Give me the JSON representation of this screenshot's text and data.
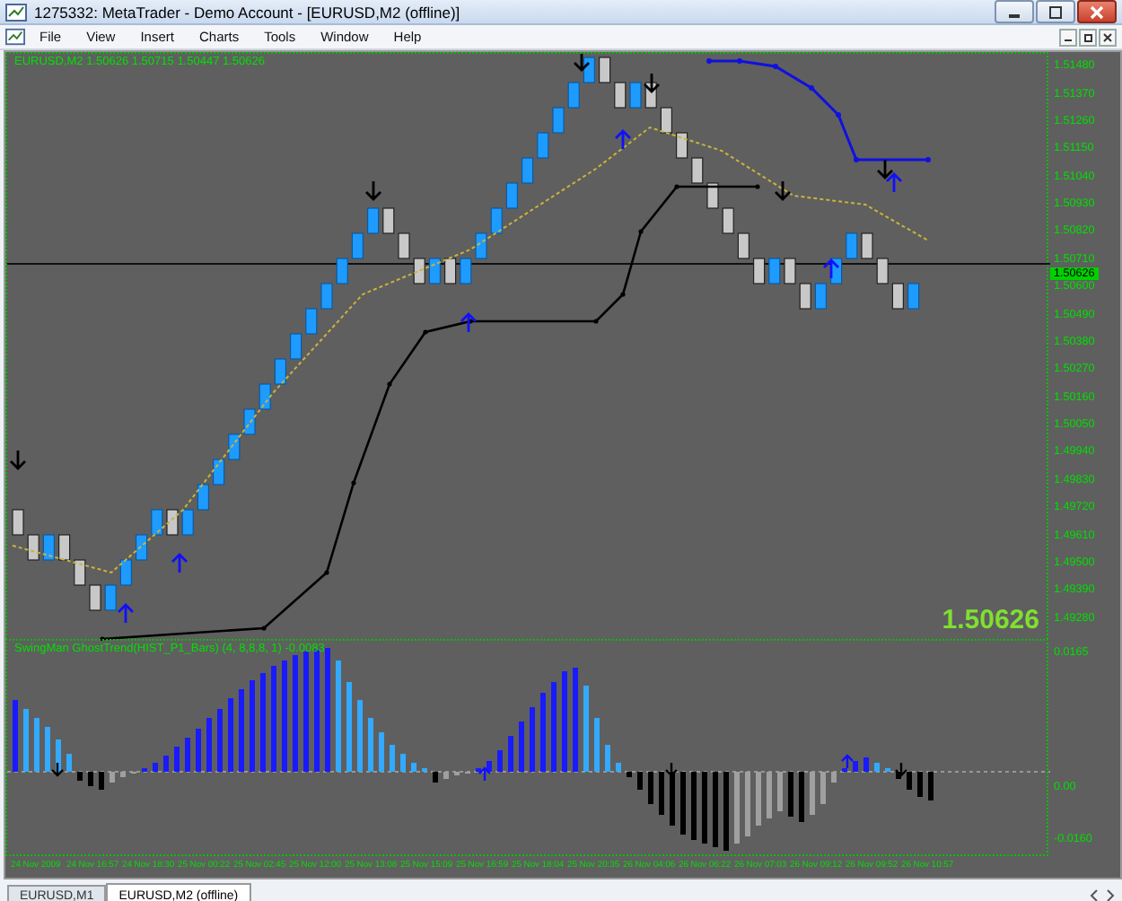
{
  "window": {
    "title": "1275332: MetaTrader - Demo Account - [EURUSD,M2 (offline)]"
  },
  "menu": [
    "File",
    "View",
    "Insert",
    "Charts",
    "Tools",
    "Window",
    "Help"
  ],
  "chart": {
    "header": "EURUSD,M2 1.50626 1.50715 1.50447 1.50626",
    "price_labels": [
      "1.51480",
      "1.51370",
      "1.51260",
      "1.51150",
      "1.51040",
      "1.50930",
      "1.50820",
      "1.50710",
      "1.50600",
      "1.50490",
      "1.50380",
      "1.50270",
      "1.50160",
      "1.50050",
      "1.49940",
      "1.49830",
      "1.49720",
      "1.49610",
      "1.49500",
      "1.49390",
      "1.49280"
    ],
    "current_price": "1.50626",
    "big_price": "1.50626"
  },
  "indicator": {
    "header": "SwingMan GhostTrend(HIST_P1_Bars) (4, 8,8,8, 1) -0.0083",
    "labels": [
      "0.0165",
      "0.00",
      "-0.0160"
    ]
  },
  "time_labels": [
    "24 Nov 2009",
    "24 Nov 16:57",
    "24 Nov 18:30",
    "25 Nov 00:22",
    "25 Nov 02:45",
    "25 Nov 12:00",
    "25 Nov 13:08",
    "25 Nov 15:09",
    "25 Nov 16:59",
    "25 Nov 18:04",
    "25 Nov 20:35",
    "26 Nov 04:06",
    "26 Nov 06:22",
    "26 Nov 07:03",
    "26 Nov 09:12",
    "26 Nov 09:52",
    "26 Nov 10:57"
  ],
  "tabs": [
    {
      "label": "EURUSD,M1",
      "selected": false
    },
    {
      "label": "EURUSD,M2 (offline)",
      "selected": true
    }
  ]
}
